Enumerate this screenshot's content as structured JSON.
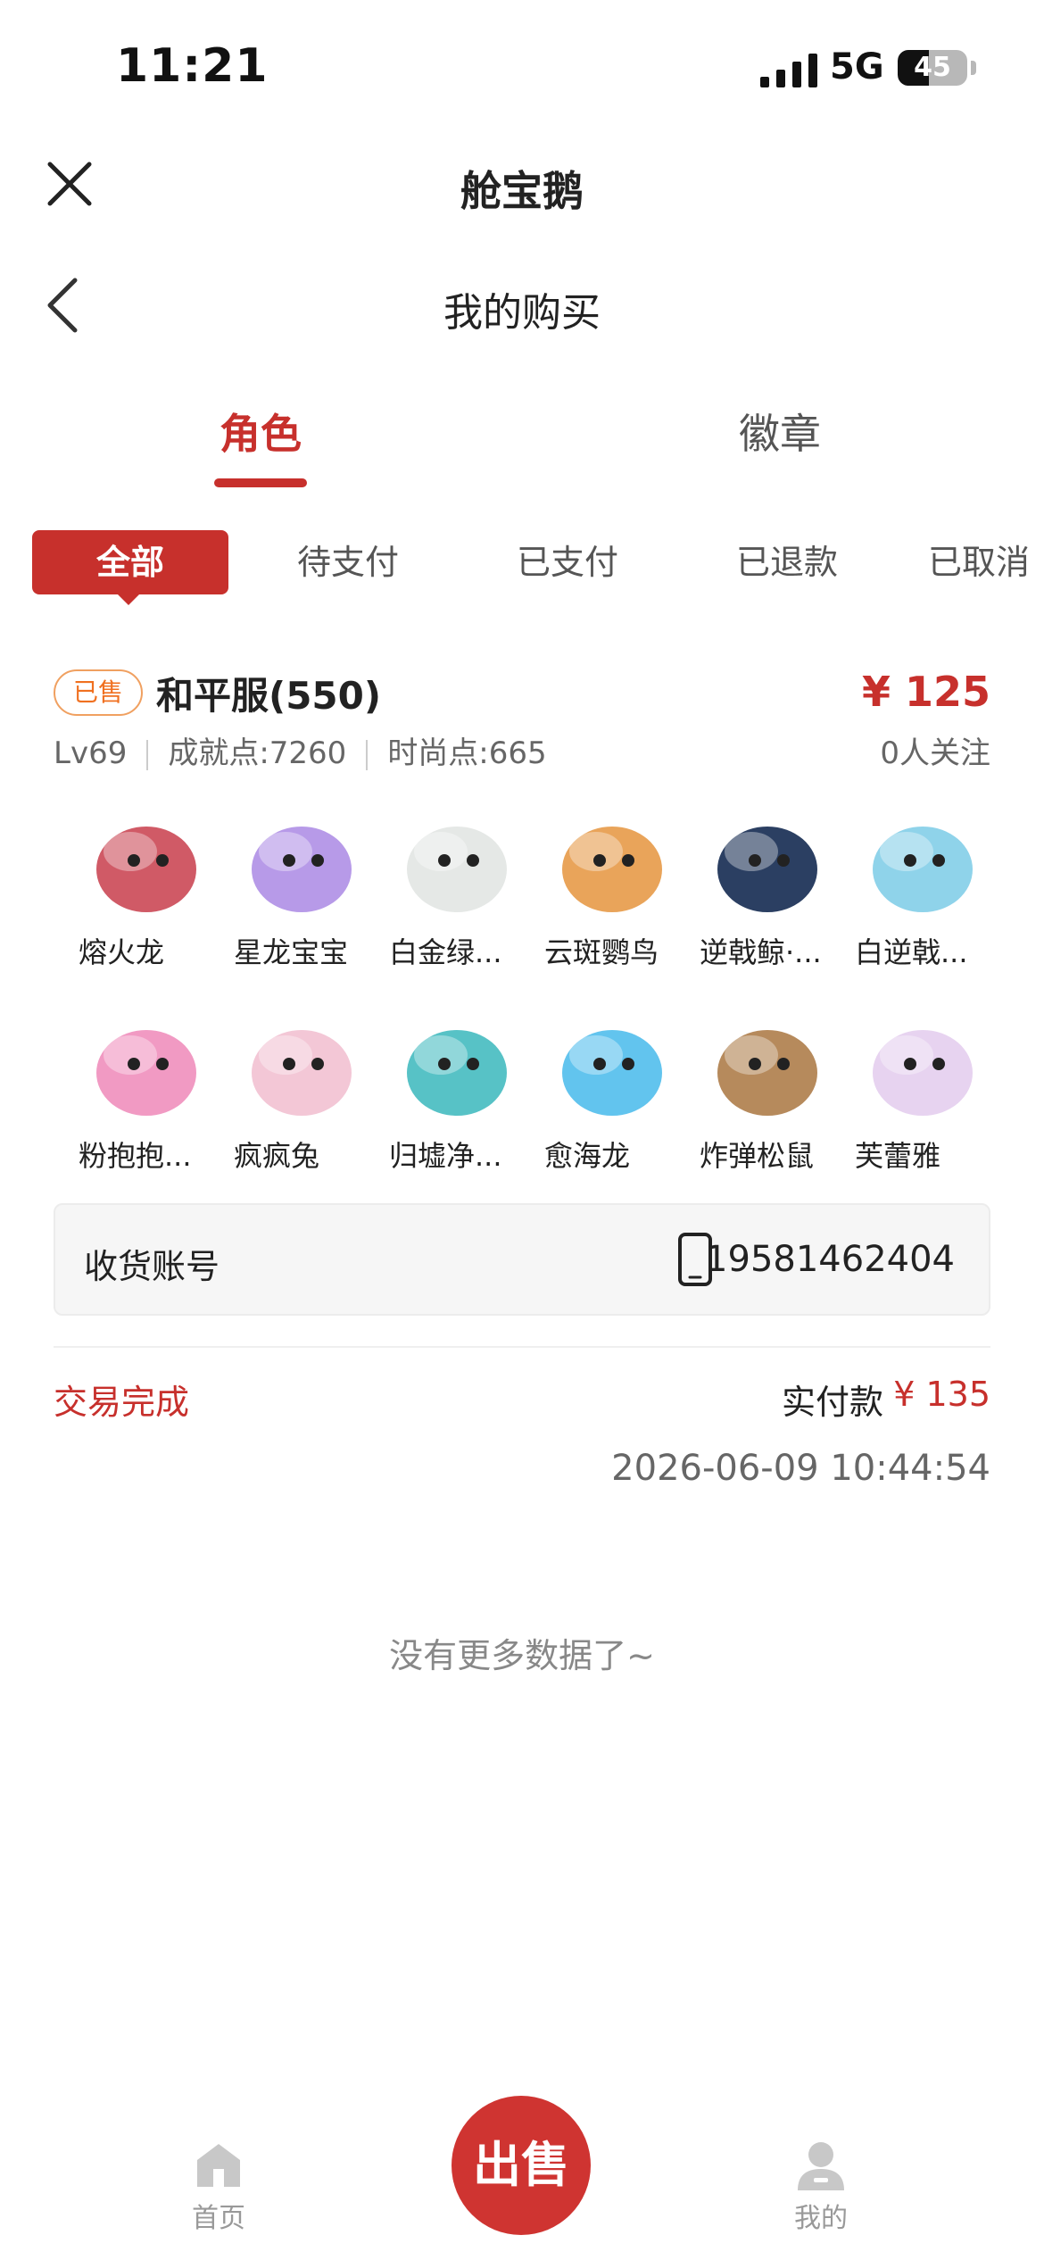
{
  "status_bar": {
    "time": "11:21",
    "network": "5G",
    "battery": "45",
    "battery_level": 0.45
  },
  "app": {
    "title": "舱宝鹅"
  },
  "page": {
    "title": "我的购买"
  },
  "main_tabs": [
    {
      "label": "角色",
      "active": true
    },
    {
      "label": "徽章",
      "active": false
    }
  ],
  "sub_tabs": [
    {
      "label": "全部",
      "active": true
    },
    {
      "label": "待支付",
      "active": false
    },
    {
      "label": "已支付",
      "active": false
    },
    {
      "label": "已退款",
      "active": false
    },
    {
      "label": "已取消",
      "active": false
    }
  ],
  "order": {
    "badge": "已售",
    "server": "和平服(550)",
    "price": "¥ 125",
    "level": "Lv69",
    "achievement": "成就点:7260",
    "fashion": "时尚点:665",
    "followers": "0人关注",
    "pets": [
      {
        "name": "熔火龙",
        "color": "#d05a66",
        "icon": "dragon-icon"
      },
      {
        "name": "星龙宝宝",
        "color": "#b79ae8",
        "icon": "dragon-icon"
      },
      {
        "name": "白金绿...",
        "color": "#e5e8e6",
        "icon": "creature-icon"
      },
      {
        "name": "云斑鹦鸟",
        "color": "#e9a45a",
        "icon": "bird-icon"
      },
      {
        "name": "逆戟鲸·...",
        "color": "#2b3f62",
        "icon": "whale-icon"
      },
      {
        "name": "白逆戟...",
        "color": "#8fd3ea",
        "icon": "whale-icon"
      },
      {
        "name": "粉抱抱...",
        "color": "#f19ac3",
        "icon": "bear-icon"
      },
      {
        "name": "疯疯兔",
        "color": "#f3c7d6",
        "icon": "rabbit-icon"
      },
      {
        "name": "归墟净...",
        "color": "#57c2c6",
        "icon": "dragon-icon"
      },
      {
        "name": "愈海龙",
        "color": "#62c4ee",
        "icon": "dragon-icon"
      },
      {
        "name": "炸弹松鼠",
        "color": "#b68a5c",
        "icon": "squirrel-icon"
      },
      {
        "name": "芙蕾雅",
        "color": "#e7d3f0",
        "icon": "character-icon"
      }
    ],
    "account_label": "收货账号",
    "account_value": "19581462404",
    "trade_status": "交易完成",
    "paid_label": "实付款",
    "paid_amount": "¥ 135",
    "time": "2026-06-09 10:44:54"
  },
  "no_more_text": "没有更多数据了~",
  "bottom_nav": {
    "home": "首页",
    "sell": "出售",
    "mine": "我的"
  },
  "colors": {
    "accent": "#c7302c",
    "badge": "#f07020"
  }
}
